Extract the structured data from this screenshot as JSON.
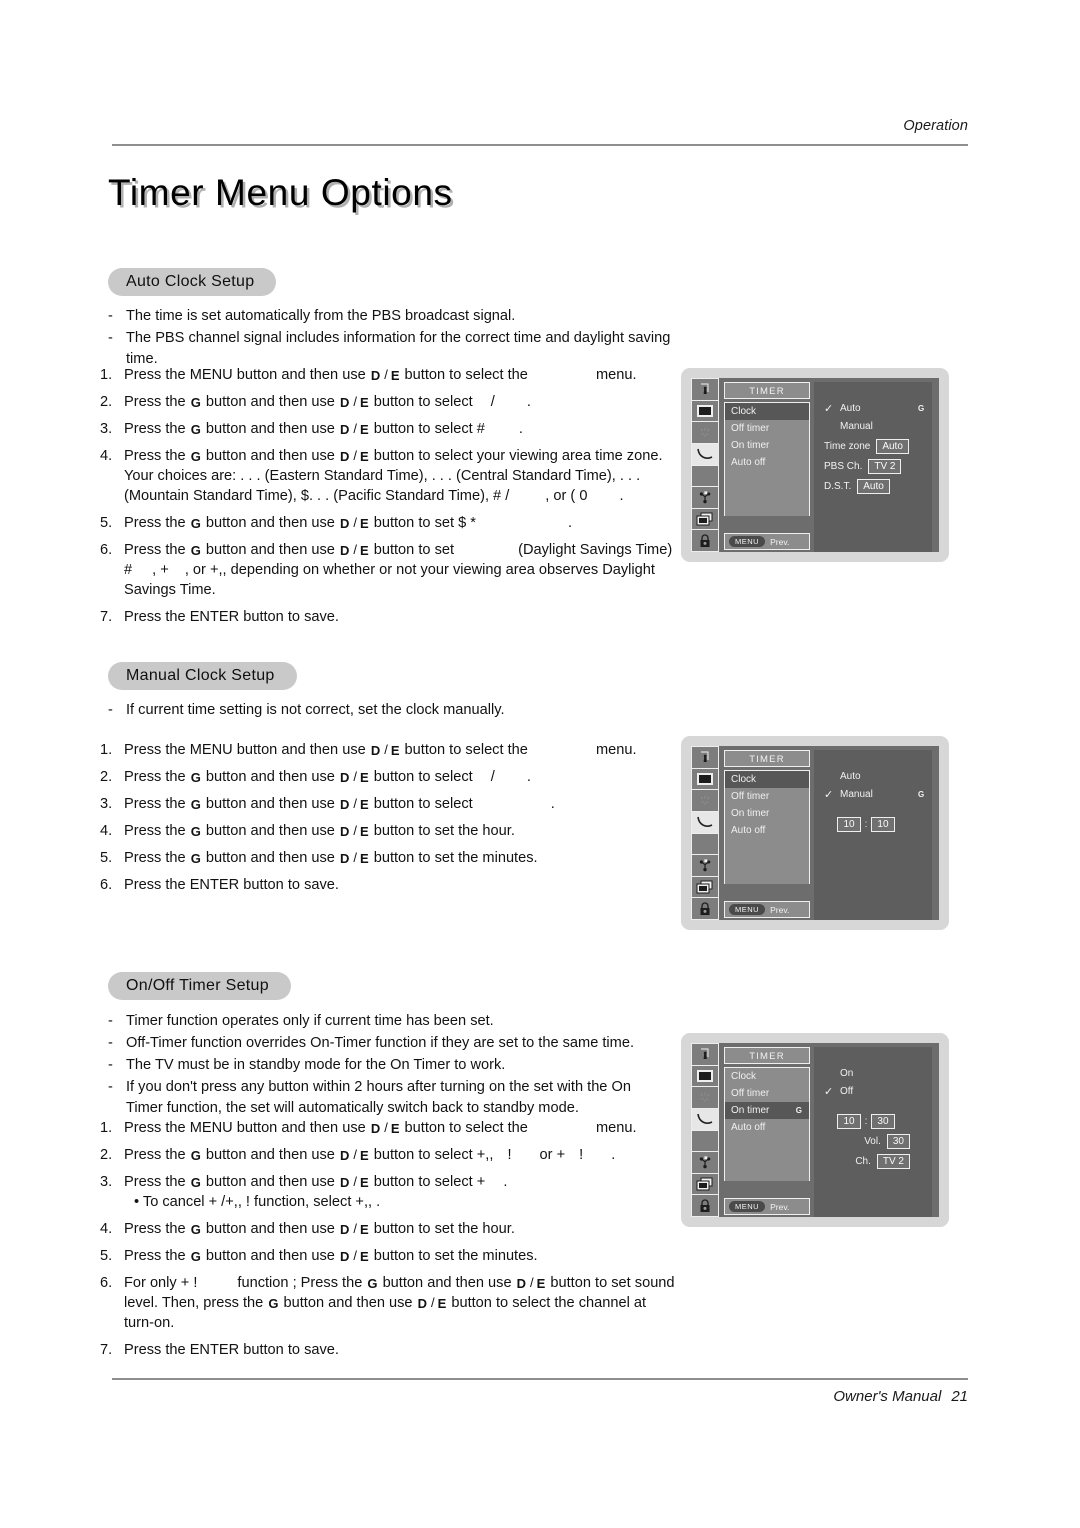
{
  "header": {
    "section_label": "Operation"
  },
  "page_title": "Timer Menu Options",
  "footer": {
    "manual_label": "Owner's Manual",
    "page_number": "21"
  },
  "keys": {
    "down": "D",
    "up": "E",
    "sep": "/",
    "right": "G"
  },
  "sections": [
    {
      "id": "auto-clock-setup",
      "heading": "Auto Clock Setup",
      "notes": [
        "The time is set automatically from the PBS broadcast signal.",
        "The PBS channel signal includes information for the correct time and daylight saving time."
      ],
      "steps": [
        {
          "num": "1.",
          "parts": [
            "Press the MENU button and then use ",
            "KEY_DE",
            " button to select the ",
            "GAP60",
            " menu."
          ]
        },
        {
          "num": "2.",
          "parts": [
            "Press the ",
            "KEY_G",
            " button and then use ",
            "KEY_DE",
            " button to select ",
            "GAP14",
            "/",
            "GAP32",
            "."
          ]
        },
        {
          "num": "3.",
          "parts": [
            "Press the ",
            "KEY_G",
            " button and then use ",
            "KEY_DE",
            " button to select #",
            "GAP34",
            "."
          ]
        },
        {
          "num": "4.",
          "parts": [
            "Press the ",
            "KEY_G",
            " button and then use ",
            "KEY_DE",
            " button to select your viewing area time zone. Your choices are:  . . . (Eastern Standard Time),  . . . (Central Standard Time),  . . . (Mountain  Standard Time), $. . . (Pacific Standard Time), # /",
            "GAP36",
            ", or ( 0",
            "GAP32",
            "."
          ]
        },
        {
          "num": "5.",
          "parts": [
            "Press the ",
            "KEY_G",
            " button and then use ",
            "KEY_DE",
            " button to set $  *",
            "GAP92",
            "."
          ]
        },
        {
          "num": "6.",
          "parts": [
            "Press the ",
            "KEY_G",
            " button and then use ",
            "KEY_DE",
            " button to set ",
            "GAP60",
            "(Daylight Savings Time) #",
            "GAP20",
            ", + ",
            "GAP12",
            ", or +,,  depending on whether or not your viewing area observes Daylight Savings Time."
          ]
        },
        {
          "num": "7.",
          "parts": [
            "Press the ENTER button to save."
          ]
        }
      ],
      "osd": {
        "title": "TIMER",
        "menu_items": [
          {
            "label": "Clock",
            "selected": true,
            "marker": ""
          },
          {
            "label": "Off timer",
            "selected": false,
            "marker": ""
          },
          {
            "label": "On timer",
            "selected": false,
            "marker": ""
          },
          {
            "label": "Auto off",
            "selected": false,
            "marker": ""
          }
        ],
        "menu_button": "MENU",
        "prev_label": "Prev.",
        "options": [
          {
            "label": "Auto",
            "checked": true,
            "marker": "G"
          },
          {
            "label": "Manual",
            "checked": false,
            "marker": ""
          }
        ],
        "fields": [
          {
            "label": "Time zone",
            "value": "Auto"
          },
          {
            "label": "PBS Ch.",
            "value": "TV 2"
          },
          {
            "label": "D.S.T.",
            "value": "Auto"
          }
        ]
      }
    },
    {
      "id": "manual-clock-setup",
      "heading": "Manual Clock Setup",
      "notes": [
        "If current time setting is not correct, set the clock manually."
      ],
      "steps": [
        {
          "num": "1.",
          "parts": [
            "Press the MENU button and then use ",
            "KEY_DE",
            " button to select the ",
            "GAP60",
            " menu."
          ]
        },
        {
          "num": "2.",
          "parts": [
            "Press the ",
            "KEY_G",
            " button and then use ",
            "KEY_DE",
            " button to select ",
            "GAP14",
            "/",
            "GAP32",
            "."
          ]
        },
        {
          "num": "3.",
          "parts": [
            "Press the ",
            "KEY_G",
            " button and then use ",
            "KEY_DE",
            " button to select ",
            "GAP74",
            "."
          ]
        },
        {
          "num": "4.",
          "parts": [
            "Press the ",
            "KEY_G",
            " button and then use ",
            "KEY_DE",
            " button to set the hour."
          ]
        },
        {
          "num": "5.",
          "parts": [
            "Press the ",
            "KEY_G",
            " button and then use ",
            "KEY_DE",
            " button to set the minutes."
          ]
        },
        {
          "num": "6.",
          "parts": [
            "Press the ENTER button to save."
          ]
        }
      ],
      "osd": {
        "title": "TIMER",
        "menu_items": [
          {
            "label": "Clock",
            "selected": true,
            "marker": ""
          },
          {
            "label": "Off timer",
            "selected": false,
            "marker": ""
          },
          {
            "label": "On timer",
            "selected": false,
            "marker": ""
          },
          {
            "label": "Auto off",
            "selected": false,
            "marker": ""
          }
        ],
        "menu_button": "MENU",
        "prev_label": "Prev.",
        "options": [
          {
            "label": "Auto",
            "checked": false,
            "marker": ""
          },
          {
            "label": "Manual",
            "checked": true,
            "marker": "G"
          }
        ],
        "time": {
          "hour": "10",
          "minute": "10",
          "separator": ":"
        }
      }
    },
    {
      "id": "on-off-timer-setup",
      "heading": "On/Off Timer Setup",
      "notes": [
        "Timer function operates only if current time has been set.",
        "Off-Timer function overrides On-Timer function if they are set to the same time.",
        "The TV must be in standby mode for the On Timer to work.",
        "If you don't press any button within 2 hours after turning on the set with the On Timer function, the set will automatically switch back to standby mode."
      ],
      "steps": [
        {
          "num": "1.",
          "parts": [
            "Press the MENU button and then use ",
            "KEY_DE",
            " button to select the ",
            "GAP60",
            " menu."
          ]
        },
        {
          "num": "2.",
          "parts": [
            "Press the ",
            "KEY_G",
            " button and then use ",
            "KEY_DE",
            " button to select +,, ",
            "GAP10",
            "! ",
            "GAP24",
            "or + ",
            "GAP10",
            "! ",
            "GAP24",
            "."
          ]
        },
        {
          "num": "3.",
          "parts": [
            "Press the ",
            "KEY_G",
            " button and then use ",
            "KEY_DE",
            " button to select + ",
            "GAP14",
            "."
          ],
          "bullet": "• To cancel +   /+,,   !      function, select +,, ."
        },
        {
          "num": "4.",
          "parts": [
            "Press the ",
            "KEY_G",
            " button and then use ",
            "KEY_DE",
            " button to set the hour."
          ]
        },
        {
          "num": "5.",
          "parts": [
            "Press the ",
            "KEY_G",
            " button and then use ",
            "KEY_DE",
            " button to set the minutes."
          ]
        },
        {
          "num": "6.",
          "parts": [
            "For only  +   !",
            "GAP40",
            "function ; Press the ",
            "KEY_G",
            " button and then use ",
            "KEY_DE",
            " button to set sound level. Then, press the ",
            "KEY_G",
            " button and then use ",
            "KEY_DE",
            " button to select the channel at turn-on."
          ]
        },
        {
          "num": "7.",
          "parts": [
            "Press the ENTER button to save."
          ]
        }
      ],
      "osd": {
        "title": "TIMER",
        "menu_items": [
          {
            "label": "Clock",
            "selected": false,
            "marker": ""
          },
          {
            "label": "Off timer",
            "selected": false,
            "marker": ""
          },
          {
            "label": "On timer",
            "selected": true,
            "marker": "G"
          },
          {
            "label": "Auto off",
            "selected": false,
            "marker": ""
          }
        ],
        "menu_button": "MENU",
        "prev_label": "Prev.",
        "options": [
          {
            "label": "On",
            "checked": false,
            "marker": ""
          },
          {
            "label": "Off",
            "checked": true,
            "marker": ""
          }
        ],
        "time": {
          "hour": "10",
          "minute": "30",
          "separator": ":"
        },
        "fields": [
          {
            "label": "Vol.",
            "value": "30"
          },
          {
            "label": "Ch.",
            "value": "TV 2"
          }
        ]
      }
    }
  ],
  "icons": {
    "sidebar": [
      "speaker-icon",
      "picture-icon",
      "sparkle-icon",
      "moon-icon",
      "blank-icon",
      "connector-icon",
      "pip-icon",
      "lock-icon"
    ],
    "check": "✓"
  },
  "colors": {
    "pill_bg": "#c9c9c9",
    "rule": "#8e8e8e",
    "osd_frame": "#d7d7d7",
    "osd_panel": "#8c8c8c",
    "osd_right": "#5e5e5e",
    "osd_selected": "#575757",
    "text": "#121212"
  }
}
